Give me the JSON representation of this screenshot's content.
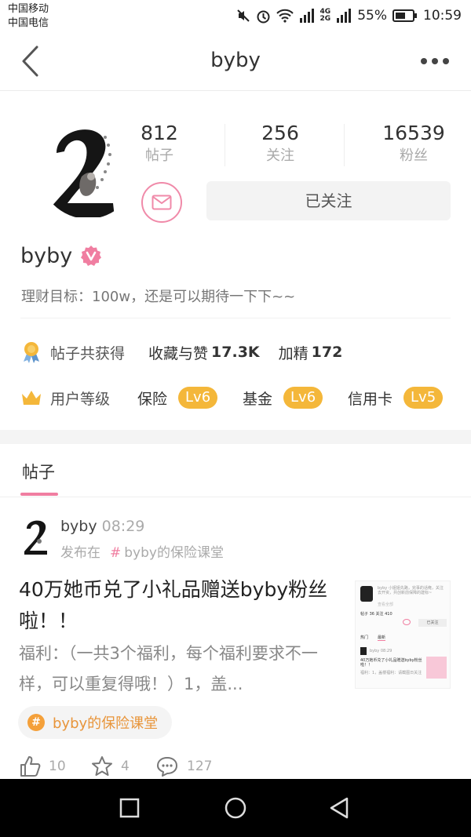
{
  "status_bar": {
    "carrier_1": "中国移动",
    "carrier_2": "中国电信",
    "net_top": "4G",
    "net_bottom": "2G",
    "battery": "55%",
    "time": "10:59",
    "icons": [
      "mute-icon",
      "alarm-icon",
      "wifi-icon",
      "signal-icon",
      "battery-icon"
    ]
  },
  "nav": {
    "title": "byby"
  },
  "profile": {
    "stats": [
      {
        "num": "812",
        "label": "帖子"
      },
      {
        "num": "256",
        "label": "关注"
      },
      {
        "num": "16539",
        "label": "粉丝"
      }
    ],
    "follow_label": "已关注",
    "name": "byby",
    "bio": "理财目标：100w，还是可以期待一下下~~",
    "achieve": {
      "label": "帖子共获得",
      "fav_label": "收藏与赞",
      "fav_value": "17.3K",
      "elite_label": "加精",
      "elite_value": "172"
    },
    "levels": {
      "label": "用户等级",
      "items": [
        {
          "name": "保险",
          "level": "Lv6"
        },
        {
          "name": "基金",
          "level": "Lv6"
        },
        {
          "name": "信用卡",
          "level": "Lv5"
        }
      ]
    }
  },
  "tabs": {
    "posts": "帖子"
  },
  "post": {
    "author": "byby",
    "time": "08:29",
    "posted_in": "发布在",
    "hash": "#",
    "channel": "byby的保险课堂",
    "title": "40万她币兑了小礼品赠送byby粉丝啦！！",
    "excerpt": "福利：（一共3个福利，每个福利要求不一样，可以重复得哦！）1，盖...",
    "thumb": {
      "bio": "byby 小姐姐先路，完事的话俺，关注去开资，共创新前保障的建标~",
      "more": "查看全部",
      "stats": "帖子 36  关注 410",
      "follow": "已关注",
      "tab_1": "热门",
      "tab_2": "最新",
      "mini_author": "byby",
      "mini_time": "08:29",
      "mini_title": "40万她币兑了小礼品赠送byby粉丝啦！！",
      "mini_excerpt": "福利：1，盖楼福利：请截图日关注"
    },
    "topic": "byby的保险课堂",
    "likes": "10",
    "favorites": "4",
    "comments": "127"
  },
  "colors": {
    "accent_pink": "#f07ea1",
    "level_badge": "#f4b73a",
    "topic_orange": "#e8953a"
  }
}
